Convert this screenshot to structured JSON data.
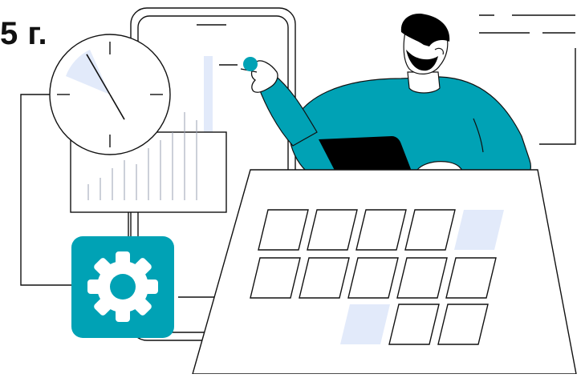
{
  "heading": {
    "text": "5 г."
  },
  "colors": {
    "accent": "#00A2B5",
    "light_blue": "#E2EAFA",
    "line": "#111111",
    "skin": "#FFFFFF",
    "hair": "#000000",
    "laptop": "#000000"
  },
  "icons": {
    "clock": "clock-icon",
    "gear": "gear-icon",
    "calendar": "calendar-icon",
    "laptop": "laptop-icon",
    "phone": "phone-icon"
  },
  "calendar": {
    "rows": [
      [
        "empty",
        "empty",
        "empty",
        "empty",
        "highlight"
      ],
      [
        "empty",
        "empty",
        "empty",
        "empty",
        "empty"
      ],
      [
        "hidden",
        "hidden",
        "highlight",
        "empty",
        "empty"
      ]
    ]
  },
  "clock": {
    "hour_hand_angle_deg": 150,
    "minute_hand_angle_deg": 330
  }
}
